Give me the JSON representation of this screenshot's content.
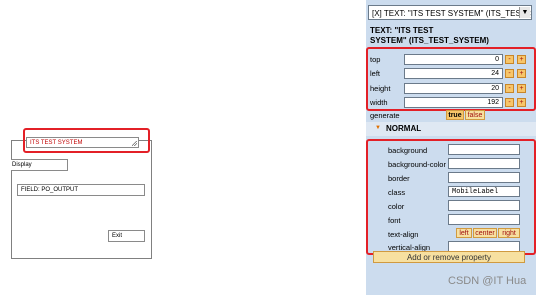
{
  "canvas": {
    "text_field_value": "ITS TEST SYSTEM",
    "display_label": "Display",
    "output_field_value": "FIELD: PO_OUTPUT",
    "exit_button_label": "Exit"
  },
  "panel": {
    "element_selector_value": "[X] TEXT: \"ITS TEST SYSTEM\" (ITS_TEST_SY",
    "element_title_line1": "TEXT: \"ITS TEST",
    "element_title_line2": "SYSTEM\" (ITS_TEST_SYSTEM)",
    "geometry": [
      {
        "label": "top",
        "value": "0"
      },
      {
        "label": "left",
        "value": "24"
      },
      {
        "label": "height",
        "value": "20"
      },
      {
        "label": "width",
        "value": "192"
      }
    ],
    "minus_label": "-",
    "plus_label": "+",
    "generate_label": "generate",
    "generate_true": "true",
    "generate_false": "false",
    "section_label": "NORMAL",
    "props": [
      {
        "label": "background",
        "value": ""
      },
      {
        "label": "background-color",
        "value": ""
      },
      {
        "label": "border",
        "value": ""
      },
      {
        "label": "class",
        "value": "MobileLabel"
      },
      {
        "label": "color",
        "value": ""
      },
      {
        "label": "font",
        "value": ""
      },
      {
        "label": "text-align",
        "value": ""
      },
      {
        "label": "vertical-align",
        "value": ""
      }
    ],
    "align_left": "left",
    "align_center": "center",
    "align_right": "right",
    "add_remove_label": "Add or remove property"
  },
  "watermark": "CSDN @IT Hua",
  "colors": {
    "highlight_red": "#e32027",
    "panel_bg": "#ccdcee",
    "button_orange": "#f7c66a"
  }
}
